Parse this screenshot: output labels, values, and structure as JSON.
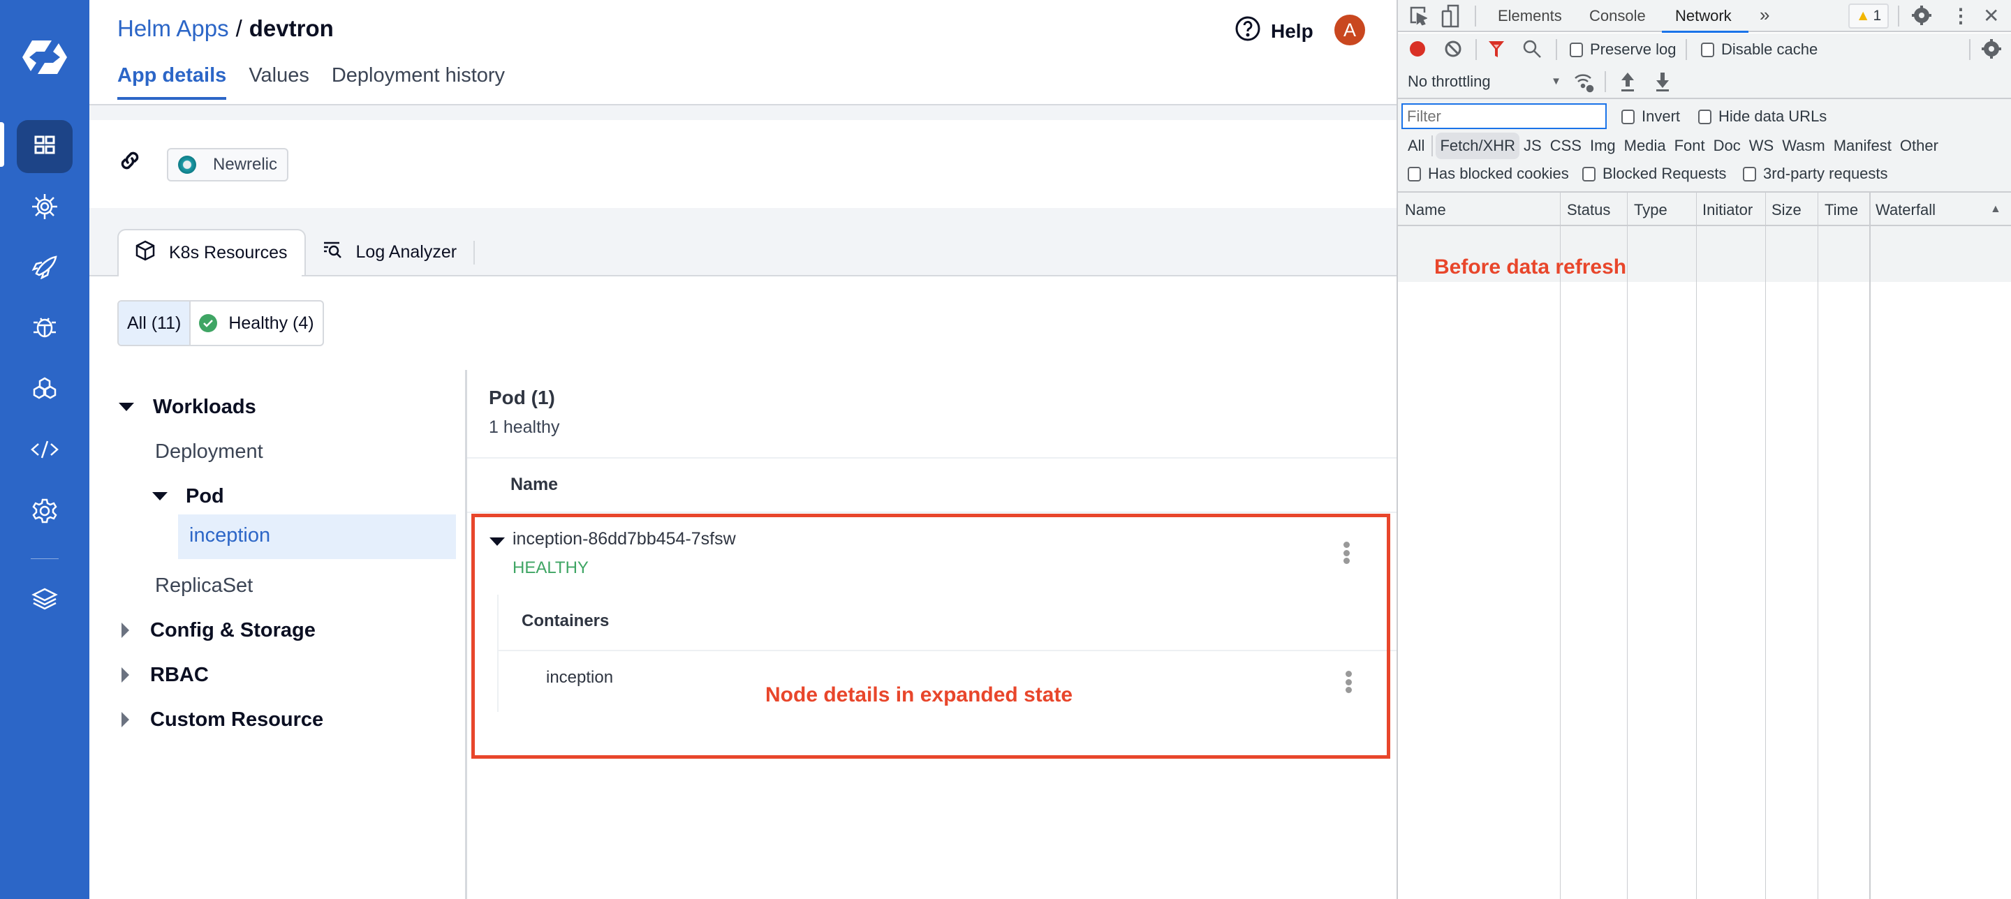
{
  "nav": {
    "items": [
      {
        "icon": "apps-grid-icon",
        "active": true
      },
      {
        "icon": "helm-wheel-icon",
        "active": false
      },
      {
        "icon": "rocket-icon",
        "active": false
      },
      {
        "icon": "bug-icon",
        "active": false
      },
      {
        "icon": "hexagons-icon",
        "active": false
      },
      {
        "icon": "code-icon",
        "active": false
      },
      {
        "icon": "gear-icon",
        "active": false
      },
      {
        "icon": "layers-icon",
        "active": false
      }
    ]
  },
  "header": {
    "breadcrumb_link": "Helm Apps",
    "breadcrumb_sep": "/",
    "app_name": "devtron",
    "help_label": "Help",
    "avatar_initial": "A",
    "tabs": [
      {
        "label": "App details",
        "active": true
      },
      {
        "label": "Values",
        "active": false
      },
      {
        "label": "Deployment history",
        "active": false
      }
    ]
  },
  "links": {
    "chip_label": "Newrelic"
  },
  "resource_tabs": [
    {
      "label": "K8s Resources",
      "icon": "cube-icon",
      "active": true
    },
    {
      "label": "Log Analyzer",
      "icon": "log-search-icon",
      "active": false
    }
  ],
  "status_filters": [
    {
      "label": "All (11)",
      "active": true
    },
    {
      "label": "Healthy (4)",
      "active": false,
      "icon": "check-circle-icon"
    }
  ],
  "tree": {
    "workloads": "Workloads",
    "deployment": "Deployment",
    "pod": "Pod",
    "selected": "inception",
    "replicaset": "ReplicaSet",
    "config_storage": "Config & Storage",
    "rbac": "RBAC",
    "custom_resource": "Custom Resource"
  },
  "pod_panel": {
    "title": "Pod (1)",
    "subtitle": "1 healthy",
    "column_name": "Name",
    "rows": [
      {
        "name": "inception-86dd7bb454-7sfsw",
        "status": "HEALTHY",
        "containers_title": "Containers",
        "containers": [
          "inception"
        ]
      }
    ]
  },
  "annotations": {
    "node_details": "Node details in expanded state",
    "before_refresh": "Before data refresh"
  },
  "devtools": {
    "tabs": [
      {
        "label": "Elements",
        "active": false
      },
      {
        "label": "Console",
        "active": false
      },
      {
        "label": "Network",
        "active": true
      }
    ],
    "warning_count": "1",
    "preserve_log": "Preserve log",
    "disable_cache": "Disable cache",
    "throttling": "No throttling",
    "filter_placeholder": "Filter",
    "invert": "Invert",
    "hide_data_urls": "Hide data URLs",
    "types": [
      "All",
      "Fetch/XHR",
      "JS",
      "CSS",
      "Img",
      "Media",
      "Font",
      "Doc",
      "WS",
      "Wasm",
      "Manifest",
      "Other"
    ],
    "active_type": "Fetch/XHR",
    "has_blocked_cookies": "Has blocked cookies",
    "blocked_requests": "Blocked Requests",
    "third_party": "3rd-party requests",
    "columns": [
      "Name",
      "Status",
      "Type",
      "Initiator",
      "Size",
      "Time",
      "Waterfall"
    ]
  }
}
